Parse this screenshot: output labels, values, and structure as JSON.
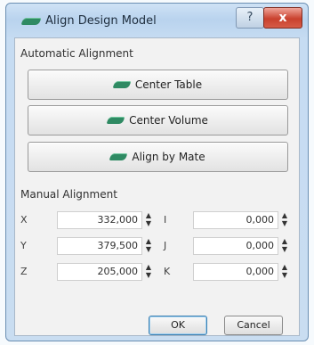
{
  "window": {
    "title": "Align Design Model",
    "help_label": "?",
    "close_label": "x"
  },
  "automatic": {
    "label": "Automatic Alignment",
    "buttons": [
      {
        "label": "Center Table",
        "icon": "model-icon"
      },
      {
        "label": "Center Volume",
        "icon": "model-icon"
      },
      {
        "label": "Align by Mate",
        "icon": "model-icon"
      }
    ]
  },
  "manual": {
    "label": "Manual Alignment",
    "left": [
      {
        "axis": "X",
        "value": "332,000"
      },
      {
        "axis": "Y",
        "value": "379,500"
      },
      {
        "axis": "Z",
        "value": "205,000"
      }
    ],
    "right": [
      {
        "axis": "I",
        "value": "0,000"
      },
      {
        "axis": "J",
        "value": "0,000"
      },
      {
        "axis": "K",
        "value": "0,000"
      }
    ]
  },
  "footer": {
    "ok_label": "OK",
    "cancel_label": "Cancel"
  },
  "colors": {
    "accent": "#2f8a63",
    "close": "#c9412e"
  }
}
